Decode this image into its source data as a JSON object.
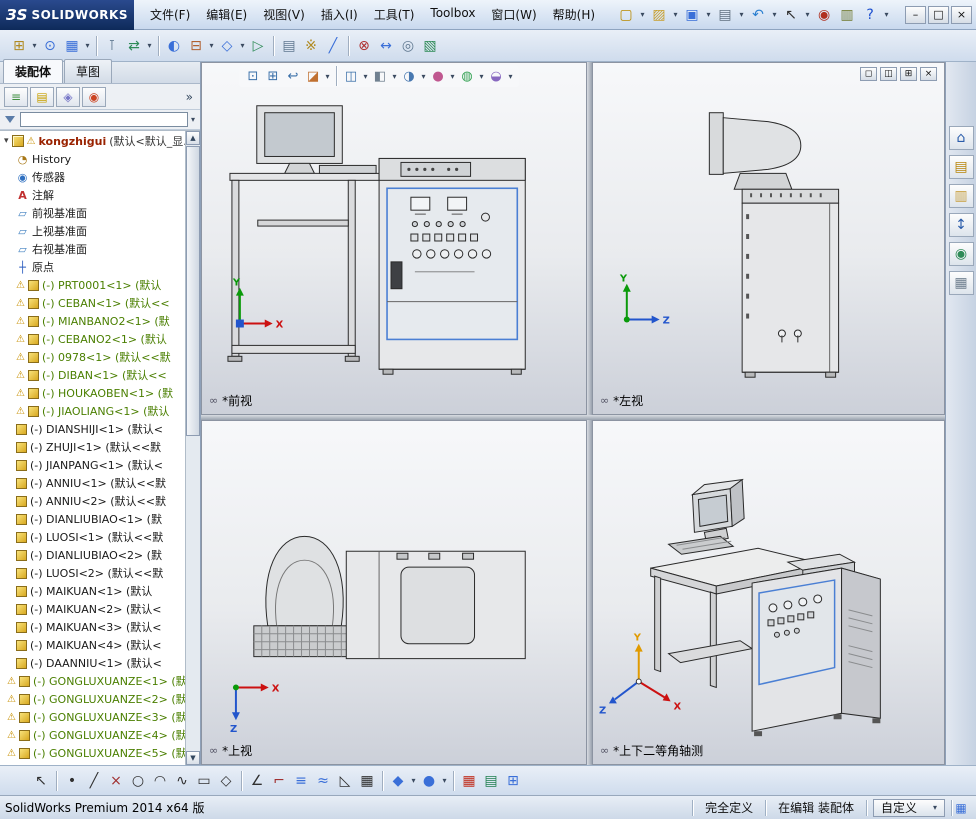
{
  "titlebar": {
    "logo_mark": "ЗS",
    "logo_text": "SOLIDWORKS",
    "menus": [
      {
        "name": "menu-file",
        "label": "文件(F)"
      },
      {
        "name": "menu-edit",
        "label": "编辑(E)"
      },
      {
        "name": "menu-view",
        "label": "视图(V)"
      },
      {
        "name": "menu-insert",
        "label": "插入(I)"
      },
      {
        "name": "menu-tools",
        "label": "工具(T)"
      },
      {
        "name": "menu-toolbox",
        "label": "Toolbox"
      },
      {
        "name": "menu-window",
        "label": "窗口(W)"
      },
      {
        "name": "menu-help",
        "label": "帮助(H)"
      }
    ],
    "quick_icons": [
      {
        "name": "new-document-icon",
        "glyph": "▢",
        "color": "#b98a00",
        "dropdown": true
      },
      {
        "name": "open-icon",
        "glyph": "▨",
        "color": "#c8a030",
        "dropdown": true
      },
      {
        "name": "save-icon",
        "glyph": "▣",
        "color": "#3a6fd8",
        "dropdown": true
      },
      {
        "name": "print-icon",
        "glyph": "▤",
        "color": "#607080",
        "dropdown": true
      },
      {
        "name": "undo-icon",
        "glyph": "↶",
        "color": "#2a7fd0",
        "dropdown": true
      },
      {
        "name": "select-icon",
        "glyph": "↖",
        "color": "#303030",
        "dropdown": true
      },
      {
        "name": "rebuild-icon",
        "glyph": "◉",
        "color": "#b03020",
        "dropdown": false
      },
      {
        "name": "file-properties-icon",
        "glyph": "▥",
        "color": "#707a30",
        "dropdown": false
      },
      {
        "name": "help-icon",
        "glyph": "?",
        "color": "#1c4fd0",
        "dropdown": true
      }
    ],
    "window_buttons": [
      {
        "name": "minimize-button",
        "glyph": "–"
      },
      {
        "name": "maximize-button",
        "glyph": "□"
      },
      {
        "name": "close-button",
        "glyph": "×"
      }
    ]
  },
  "assembly_toolbar": {
    "icons": [
      {
        "name": "insert-components-icon",
        "glyph": "⊞",
        "color": "#b08a20",
        "dropdown": true
      },
      {
        "name": "mate-icon",
        "glyph": "⊙",
        "color": "#3a6fd8",
        "dropdown": false
      },
      {
        "name": "linear-component-pattern-icon",
        "glyph": "▦",
        "color": "#3a6fd8",
        "dropdown": true
      },
      {
        "sep": true
      },
      {
        "name": "smart-fasteners-icon",
        "glyph": "⊺",
        "color": "#607890",
        "dropdown": false
      },
      {
        "name": "move-component-icon",
        "glyph": "⇄",
        "color": "#2e8b57",
        "dropdown": true
      },
      {
        "sep": true
      },
      {
        "name": "show-hidden-components-icon",
        "glyph": "◐",
        "color": "#3a6fd8",
        "dropdown": false
      },
      {
        "name": "assembly-features-icon",
        "glyph": "⊟",
        "color": "#b06030",
        "dropdown": true
      },
      {
        "name": "reference-geometry-icon",
        "glyph": "◇",
        "color": "#3a6fd8",
        "dropdown": true
      },
      {
        "name": "new-motion-study-icon",
        "glyph": "▷",
        "color": "#2e8b57",
        "dropdown": false
      },
      {
        "sep": true
      },
      {
        "name": "bill-of-materials-icon",
        "glyph": "▤",
        "color": "#607890",
        "dropdown": false
      },
      {
        "name": "exploded-view-icon",
        "glyph": "※",
        "color": "#b08a20",
        "dropdown": false
      },
      {
        "name": "explode-line-sketch-icon",
        "glyph": "╱",
        "color": "#3a6fd8",
        "dropdown": false
      },
      {
        "sep": true
      },
      {
        "name": "interference-detection-icon",
        "glyph": "⊗",
        "color": "#b03030",
        "dropdown": false
      },
      {
        "name": "clearance-verification-icon",
        "glyph": "↔",
        "color": "#3a6fd8",
        "dropdown": false
      },
      {
        "name": "hole-alignment-icon",
        "glyph": "◎",
        "color": "#607890",
        "dropdown": false
      },
      {
        "name": "assembly-visualization-icon",
        "glyph": "▧",
        "color": "#2e8b57",
        "dropdown": false
      }
    ]
  },
  "featuremanager": {
    "tabs": [
      {
        "name": "tab-assembly",
        "label": "装配体",
        "active": true
      },
      {
        "name": "tab-sketch",
        "label": "草图",
        "active": false
      }
    ],
    "panel_tabs": [
      {
        "name": "featuremanager-tree-tab",
        "glyph": "≡",
        "color": "#3f8f3f"
      },
      {
        "name": "propertymanager-tab",
        "glyph": "▤",
        "color": "#c8a000"
      },
      {
        "name": "configurationmanager-tab",
        "glyph": "◈",
        "color": "#7878c8"
      },
      {
        "name": "displaymanager-tab",
        "glyph": "◉",
        "color": "#cc4422"
      }
    ],
    "overflow": "»",
    "root": {
      "name": "kongzhigui",
      "suffix": "(默认<默认_显..."
    },
    "tree": {
      "items": [
        {
          "icon": "history",
          "label": "History"
        },
        {
          "icon": "sensors",
          "label": "传感器"
        },
        {
          "icon": "annotations",
          "label": "注解"
        },
        {
          "icon": "plane",
          "label": "前视基准面"
        },
        {
          "icon": "plane",
          "label": "上视基准面"
        },
        {
          "icon": "plane",
          "label": "右视基准面"
        },
        {
          "icon": "origin",
          "label": "原点"
        },
        {
          "icon": "part",
          "warn": true,
          "green": true,
          "label": "(-) PRT0001<1> (默认"
        },
        {
          "icon": "part",
          "warn": true,
          "green": true,
          "label": "(-) CEBAN<1> (默认<<"
        },
        {
          "icon": "part",
          "warn": true,
          "green": true,
          "label": "(-) MIANBANO2<1> (默"
        },
        {
          "icon": "part",
          "warn": true,
          "green": true,
          "label": "(-) CEBANO2<1> (默认"
        },
        {
          "icon": "part",
          "warn": true,
          "green": true,
          "label": "(-) 0978<1> (默认<<默"
        },
        {
          "icon": "part",
          "warn": true,
          "green": true,
          "label": "(-) DIBAN<1> (默认<<"
        },
        {
          "icon": "part",
          "warn": true,
          "green": true,
          "label": "(-) HOUKAOBEN<1> (默"
        },
        {
          "icon": "part",
          "warn": true,
          "green": true,
          "label": "(-) JIAOLIANG<1> (默认"
        },
        {
          "icon": "part",
          "label": "(-) DIANSHIJI<1> (默认<"
        },
        {
          "icon": "part",
          "label": "(-) ZHUJI<1> (默认<<默"
        },
        {
          "icon": "part",
          "label": "(-) JIANPANG<1> (默认<"
        },
        {
          "icon": "part",
          "label": "(-) ANNIU<1> (默认<<默"
        },
        {
          "icon": "part",
          "label": "(-) ANNIU<2> (默认<<默"
        },
        {
          "icon": "part",
          "label": "(-) DIANLIUBIAO<1> (默"
        },
        {
          "icon": "part",
          "label": "(-) LUOSI<1> (默认<<默"
        },
        {
          "icon": "part",
          "label": "(-) DIANLIUBIAO<2> (默"
        },
        {
          "icon": "part",
          "label": "(-) LUOSI<2> (默认<<默"
        },
        {
          "icon": "part",
          "label": "(-) MAIKUAN<1> (默认"
        },
        {
          "icon": "part",
          "label": "(-) MAIKUAN<2> (默认<"
        },
        {
          "icon": "part",
          "label": "(-) MAIKUAN<3> (默认<"
        },
        {
          "icon": "part",
          "label": "(-) MAIKUAN<4> (默认<"
        },
        {
          "icon": "part",
          "label": "(-) DAANNIU<1> (默认<"
        },
        {
          "icon": "part",
          "warn": true,
          "green": true,
          "label": "(-) GONGLUXUANZE<1> (默"
        },
        {
          "icon": "part",
          "warn": true,
          "green": true,
          "label": "(-) GONGLUXUANZE<2> (默"
        },
        {
          "icon": "part",
          "warn": true,
          "green": true,
          "label": "(-) GONGLUXUANZE<3> (默"
        },
        {
          "icon": "part",
          "warn": true,
          "green": true,
          "label": "(-) GONGLUXUANZE<4> (默"
        },
        {
          "icon": "part",
          "warn": true,
          "green": true,
          "label": "(-) GONGLUXUANZE<5> (默"
        }
      ]
    }
  },
  "graphics": {
    "headsup_icons": [
      {
        "name": "zoom-to-fit-icon",
        "glyph": "⊡",
        "color": "#3a6fa8"
      },
      {
        "name": "zoom-to-area-icon",
        "glyph": "⊞",
        "color": "#3a6fa8"
      },
      {
        "name": "previous-view-icon",
        "glyph": "↩",
        "color": "#3a6fa8"
      },
      {
        "name": "section-view-icon",
        "glyph": "◪",
        "color": "#c07030",
        "dropdown": true
      },
      {
        "sep": true
      },
      {
        "name": "view-orientation-icon",
        "glyph": "◫",
        "color": "#3a6fa8",
        "dropdown": true
      },
      {
        "name": "display-style-icon",
        "glyph": "◧",
        "color": "#708090",
        "dropdown": true
      },
      {
        "name": "hide-show-items-icon",
        "glyph": "◑",
        "color": "#4878b0",
        "dropdown": true
      },
      {
        "name": "edit-appearance-icon",
        "glyph": "●",
        "color": "#c05890",
        "dropdown": true
      },
      {
        "name": "apply-scene-icon",
        "glyph": "◍",
        "color": "#30a050",
        "dropdown": true
      },
      {
        "name": "view-settings-icon",
        "glyph": "◒",
        "color": "#8868c0",
        "dropdown": true
      }
    ],
    "viewport_controls": [
      {
        "name": "viewport-single-button",
        "glyph": "◻"
      },
      {
        "name": "viewport-two-view-button",
        "glyph": "◫"
      },
      {
        "name": "viewport-four-view-button",
        "glyph": "⊞"
      },
      {
        "name": "viewport-close-button",
        "glyph": "×"
      }
    ]
  },
  "viewports": {
    "front": {
      "label": "*前视"
    },
    "left": {
      "label": "*左视"
    },
    "top": {
      "label": "*上视"
    },
    "iso": {
      "label": "*上下二等角轴测"
    }
  },
  "taskpane": {
    "icons": [
      {
        "name": "solidworks-resources-icon",
        "glyph": "⌂",
        "color": "#2a5caa"
      },
      {
        "name": "design-library-icon",
        "glyph": "▤",
        "color": "#b8860b"
      },
      {
        "name": "file-explorer-icon",
        "glyph": "▥",
        "color": "#c8a040"
      },
      {
        "name": "view-palette-icon",
        "glyph": "↕",
        "color": "#2a5caa"
      },
      {
        "name": "appearances-scenes-icon",
        "glyph": "◉",
        "color": "#2e8b57"
      },
      {
        "name": "custom-properties-icon",
        "glyph": "▦",
        "color": "#708090"
      }
    ]
  },
  "sketch_toolbar": {
    "icons": [
      {
        "name": "select-tool-icon",
        "glyph": "↖",
        "color": "#303030"
      },
      {
        "sep": true
      },
      {
        "name": "point-tool-icon",
        "glyph": "•",
        "color": "#303030"
      },
      {
        "name": "line-tool-icon",
        "glyph": "╱",
        "color": "#303030"
      },
      {
        "name": "erase-tool-icon",
        "glyph": "×",
        "color": "#a03030"
      },
      {
        "name": "circle-tool-icon",
        "glyph": "○",
        "color": "#303030"
      },
      {
        "name": "arc-tool-icon",
        "glyph": "◠",
        "color": "#303030"
      },
      {
        "name": "spline-tool-icon",
        "glyph": "∿",
        "color": "#303030"
      },
      {
        "name": "rectangle-tool-icon",
        "glyph": "▭",
        "color": "#303030"
      },
      {
        "name": "polygon-tool-icon",
        "glyph": "◇",
        "color": "#303030"
      },
      {
        "sep": true
      },
      {
        "name": "smart-dimension-icon",
        "glyph": "∠",
        "color": "#303030"
      },
      {
        "name": "trim-entities-icon",
        "glyph": "⌐",
        "color": "#a03030"
      },
      {
        "name": "convert-entities-icon",
        "glyph": "≡",
        "color": "#3a6fd8"
      },
      {
        "name": "offset-entities-icon",
        "glyph": "≈",
        "color": "#3a6fd8"
      },
      {
        "name": "mirror-entities-icon",
        "glyph": "◺",
        "color": "#303030"
      },
      {
        "name": "linear-sketch-pattern-icon",
        "glyph": "▦",
        "color": "#303030"
      },
      {
        "sep": true
      },
      {
        "name": "isometric-view-icon",
        "glyph": "◆",
        "color": "#3a6fd8",
        "dropdown": true
      },
      {
        "name": "display-style-icon",
        "glyph": "●",
        "color": "#3a6fd8",
        "dropdown": true
      },
      {
        "sep": true
      },
      {
        "name": "section-grid-icon",
        "glyph": "▦",
        "color": "#c03020"
      },
      {
        "name": "measure-tool-icon",
        "glyph": "▤",
        "color": "#208050"
      },
      {
        "name": "options-grid-icon",
        "glyph": "⊞",
        "color": "#3a6fd8"
      }
    ]
  },
  "statusbar": {
    "product": "SolidWorks Premium 2014 x64 版",
    "definition_status": "完全定义",
    "editing_status": "在编辑 装配体",
    "custom_label": "自定义"
  },
  "glyphs": {
    "dropdown": "▾",
    "expander_open": "▾",
    "warn": "⚠",
    "link_views": "∞",
    "status_grid": "▦",
    "history": "◔",
    "sensors": "◉",
    "annotations": "A",
    "plane": "▱",
    "origin": "┼",
    "scroll_up": "▲",
    "scroll_down": "▼"
  }
}
